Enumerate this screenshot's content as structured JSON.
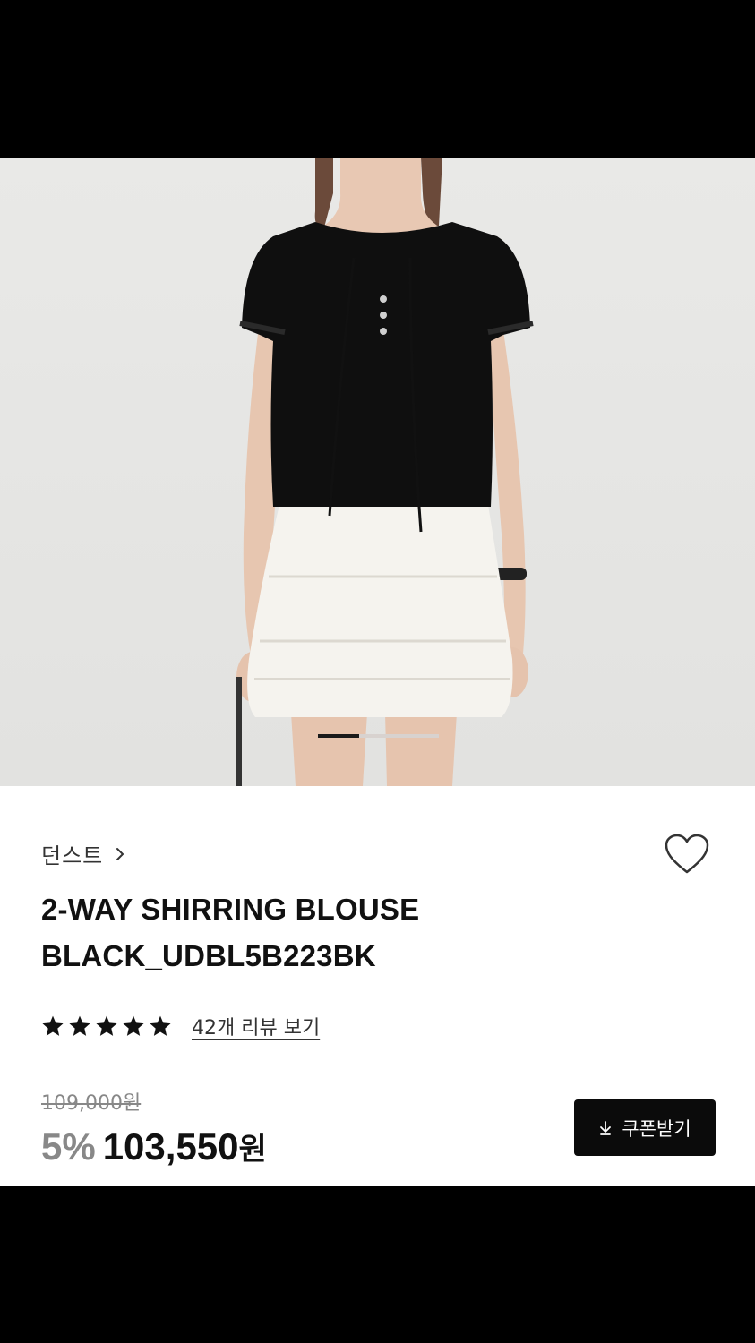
{
  "product": {
    "brand": "던스트",
    "title_line1": "2-WAY SHIRRING BLOUSE",
    "title_line2": "BLACK_UDBL5B223BK",
    "rating_stars": 5,
    "review_link": "42개 리뷰 보기",
    "original_price": "109,000원",
    "discount": "5%",
    "sale_price": "103,550",
    "currency": "원"
  },
  "coupon": {
    "label": "쿠폰받기"
  },
  "carousel": {
    "active_index": 1
  },
  "icons": {
    "brand_chevron": "chevron-right-icon",
    "wishlist": "heart-outline-icon",
    "star": "star-filled-icon",
    "coupon": "download-icon"
  },
  "colors": {
    "background": "#ffffff",
    "button": "#0b0b0b",
    "discount": "#888888",
    "star": "#111111"
  }
}
